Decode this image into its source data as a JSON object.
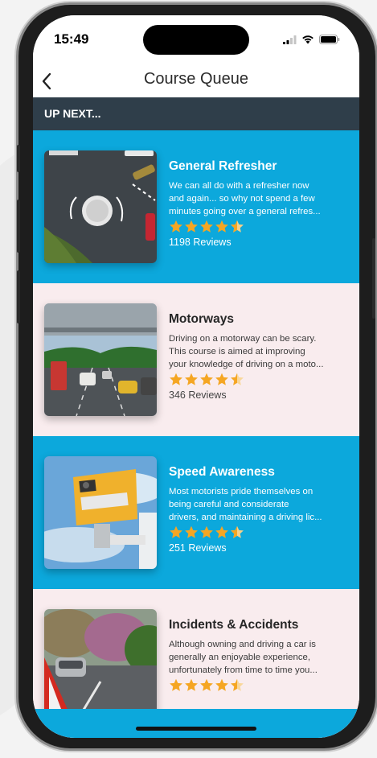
{
  "status": {
    "time": "15:49"
  },
  "nav": {
    "title": "Course Queue"
  },
  "section": {
    "label": "UP NEXT..."
  },
  "colors": {
    "accent": "#0ca8dc",
    "header": "#2f3e4a",
    "alt_row": "#f9ecee",
    "star": "#f5a623"
  },
  "courses": [
    {
      "title": "General Refresher",
      "description": [
        "We can all do with a refresher now",
        "and again... so why not spend a few",
        "minutes going over a general refres..."
      ],
      "rating": 4.5,
      "reviews": "1198 Reviews",
      "thumbnail_icon": "roundabout-aerial-icon"
    },
    {
      "title": "Motorways",
      "description": [
        "Driving on a motorway can be scary.",
        "This course is aimed at improving",
        "your knowledge of driving on a moto..."
      ],
      "rating": 4.5,
      "reviews": "346 Reviews",
      "thumbnail_icon": "motorway-traffic-icon"
    },
    {
      "title": "Speed Awareness",
      "description": [
        "Most motorists pride themselves on",
        "being careful and considerate",
        "drivers, and maintaining a driving lic..."
      ],
      "rating": 4.5,
      "reviews": "251 Reviews",
      "thumbnail_icon": "speed-camera-icon"
    },
    {
      "title": "Incidents & Accidents",
      "description": [
        "Although owning and driving a car is",
        "generally an enjoyable experience,",
        "unfortunately from time to time you..."
      ],
      "rating": 4.5,
      "reviews": "",
      "thumbnail_icon": "warning-triangle-icon"
    }
  ]
}
